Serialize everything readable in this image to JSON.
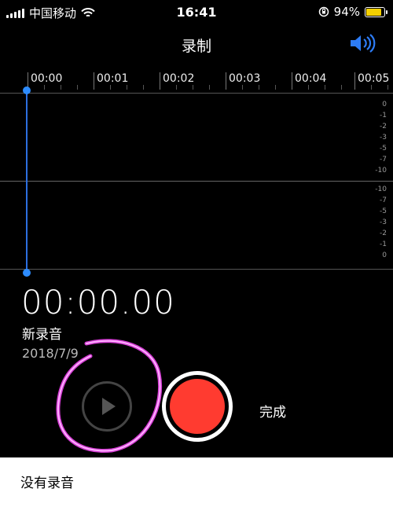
{
  "status_bar": {
    "carrier": "中国移动",
    "time": "16:41",
    "battery_percent": "94%",
    "battery_level": 0.94,
    "battery_color": "#f4d000"
  },
  "header": {
    "title": "录制",
    "speaker_icon": "speaker-icon"
  },
  "timeline": {
    "labels": [
      "00:00",
      "00:01",
      "00:02",
      "00:03",
      "00:04",
      "00:05"
    ]
  },
  "level_meter": {
    "top_channel": [
      "0",
      "-1",
      "-2",
      "-3",
      "-5",
      "-7",
      "-10"
    ],
    "bottom_channel": [
      "-10",
      "-7",
      "-5",
      "-3",
      "-2",
      "-1",
      "0"
    ]
  },
  "recording": {
    "elapsed": "00:00.00",
    "name": "新录音",
    "date": "2018/7/9"
  },
  "controls": {
    "play_icon": "play-icon",
    "record_color": "#ff3b30",
    "done_label": "完成"
  },
  "bottom_sheet": {
    "label": "没有录音"
  }
}
